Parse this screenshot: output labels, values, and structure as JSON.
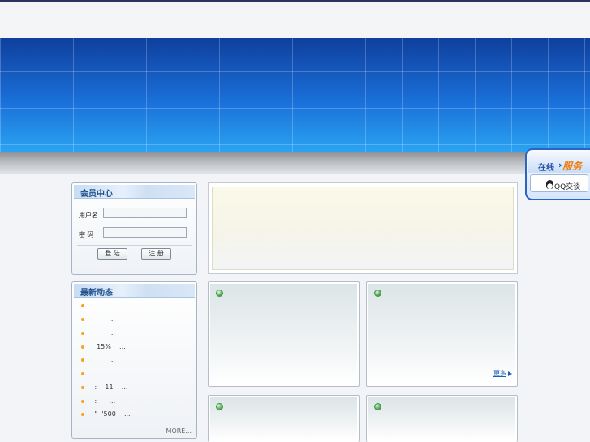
{
  "header": {
    "site_title": ""
  },
  "member_center": {
    "title": "会员中心",
    "username_label": "用户名",
    "username_value": "",
    "password_label": "密 码",
    "password_value": "",
    "login_button": "登 陆",
    "register_button": "注 册"
  },
  "news": {
    "title": "最新动态",
    "items": [
      {
        "text": "        ..."
      },
      {
        "text": "        ..."
      },
      {
        "text": "        ..."
      },
      {
        "text": "  15%    ..."
      },
      {
        "text": "        ..."
      },
      {
        "text": "        ..."
      },
      {
        "text": " :    11    ..."
      },
      {
        "text": " :      ..."
      },
      {
        "text": " \"  '500    ..."
      }
    ],
    "more": "MORE..."
  },
  "boxes": {
    "more_label": "更多"
  },
  "float_service": {
    "online": "在线",
    "service": "服务",
    "qq_label": "QQ交谈"
  },
  "colors": {
    "banner_blue": "#1765cf",
    "accent_orange": "#f3a521",
    "title_blue": "#1b4c8a"
  }
}
